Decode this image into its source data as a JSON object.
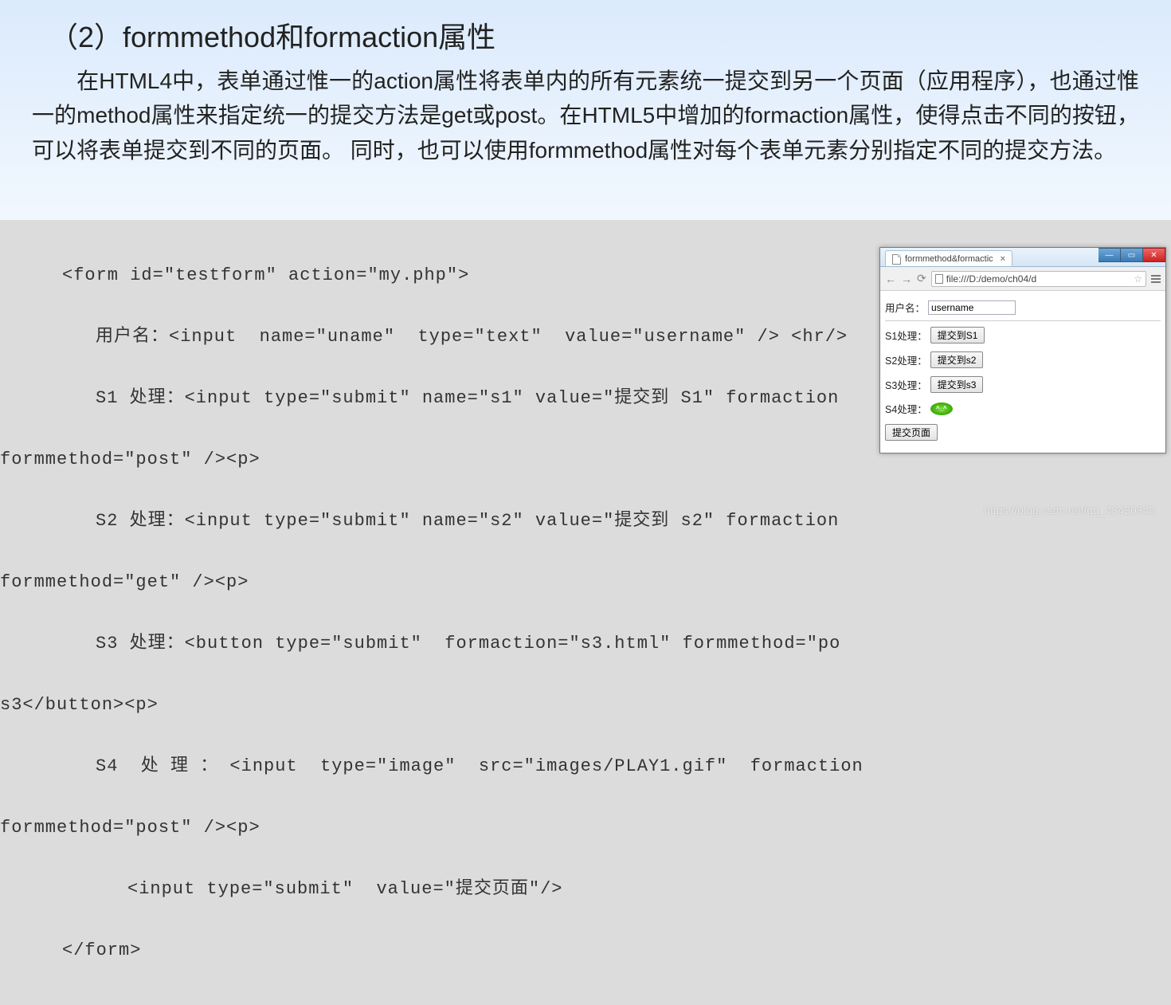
{
  "heading": "（2）formmethod和formaction属性",
  "paragraph": "在HTML4中，表单通过惟一的action属性将表单内的所有元素统一提交到另一个页面（应用程序），也通过惟一的method属性来指定统一的提交方法是get或post。在HTML5中增加的formaction属性，使得点击不同的按钮，可以将表单提交到不同的页面。 同时，也可以使用formmethod属性对每个表单元素分别指定不同的提交方法。",
  "code": {
    "l1": "<form id=\"testform\" action=\"my.php\">",
    "l2": "用户名：<input  name=\"uname\"  type=\"text\"  value=\"username\" /> <hr/>",
    "l3": "S1 处理：<input type=\"submit\" name=\"s1\" value=\"提交到 S1\" formaction",
    "l3b": "formmethod=\"post\" /><p>",
    "l4": "S2 处理：<input type=\"submit\" name=\"s2\" value=\"提交到 s2\" formaction",
    "l4b": "formmethod=\"get\" /><p>",
    "l5": "S3 处理：<button type=\"submit\"  formaction=\"s3.html\" formmethod=\"po",
    "l5b": "s3</button><p>",
    "l6": "S4  处 理 ： <input  type=\"image\"  src=\"images/PLAY1.gif\"  formaction",
    "l6b": "formmethod=\"post\" /><p>",
    "l7": "<input type=\"submit\"  value=\"提交页面\"/>",
    "l8": "</form>"
  },
  "browser": {
    "tab_title": "formmethod&formactic",
    "url": "file:///D:/demo/ch04/d",
    "labels": {
      "username": "用户名：",
      "s1": "S1处理：",
      "s2": "S2处理：",
      "s3": "S3处理：",
      "s4": "S4处理："
    },
    "values": {
      "username_input": "username",
      "btn_s1": "提交到S1",
      "btn_s2": "提交到s2",
      "btn_s3": "提交到s3",
      "btn_page": "提交页面",
      "play_text": "^_^"
    }
  },
  "watermark": "https://blog.csdn.net/qq_43430343"
}
